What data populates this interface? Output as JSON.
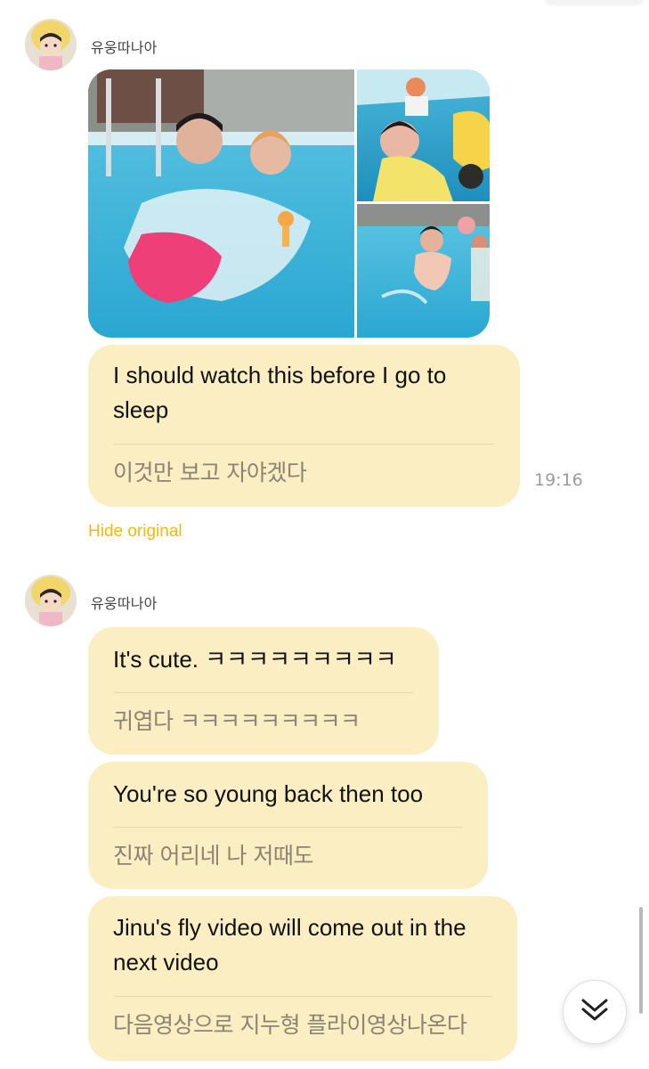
{
  "messages": [
    {
      "sender": "유웅따나아",
      "translation": "I should watch this before I go to sleep",
      "original": "이것만 보고 자야겠다",
      "time": "19:16",
      "hide_label": "Hide original"
    },
    {
      "sender": "유웅따나아",
      "items": [
        {
          "translation": "It's cute. ㅋㅋㅋㅋㅋㅋㅋㅋㅋ",
          "original": "귀엽다 ㅋㅋㅋㅋㅋㅋㅋㅋㅋ"
        },
        {
          "translation": "You're so young back then too",
          "original": "진짜 어리네 나 저때도"
        },
        {
          "translation": "Jinu's fly video will come out in the next video",
          "original": "다음영상으로 지누형 플라이영상나온다"
        }
      ]
    }
  ],
  "icons": {
    "avatar": "avatar-photo",
    "scroll_down": "chevron-double-down-icon"
  },
  "colors": {
    "bubble": "#fbeec2",
    "hide_original": "#f2b711",
    "time": "#9b9b9b"
  }
}
